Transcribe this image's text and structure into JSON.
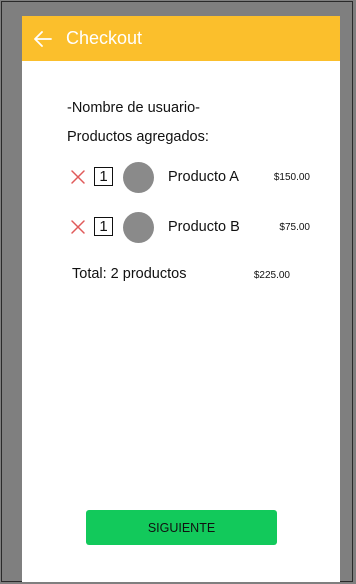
{
  "appbar": {
    "title": "Checkout",
    "back_icon": "arrow-left-icon",
    "color": "#fbbf2c"
  },
  "user": {
    "name": "-Nombre de usuario-"
  },
  "cart": {
    "section_label": "Productos agregados:",
    "items": [
      {
        "quantity": "1",
        "name": "Producto A",
        "price": "$150.00",
        "remove_icon": "close-icon"
      },
      {
        "quantity": "1",
        "name": "Producto B",
        "price": "$75.00",
        "remove_icon": "close-icon"
      }
    ],
    "total_label": "Total: 2 productos",
    "total_price": "$225.00"
  },
  "actions": {
    "next_label": "SIGUIENTE",
    "next_color": "#12c95b"
  }
}
